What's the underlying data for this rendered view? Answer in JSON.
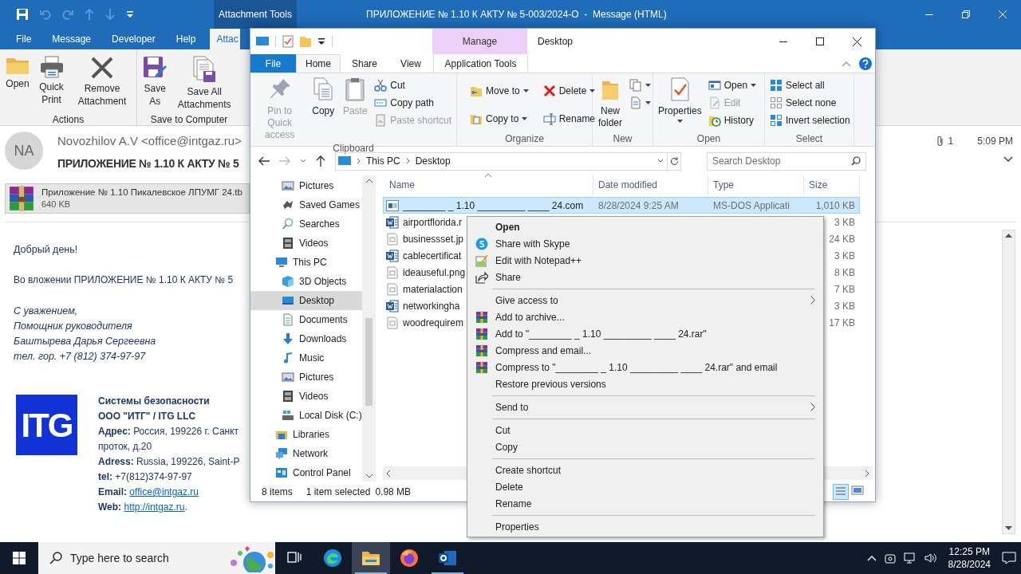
{
  "outlook": {
    "contextual_group": "Attachment Tools",
    "title": "ПРИЛОЖЕНИЕ № 1.10 К АКТУ № 5-003/2024-О  -  Message (HTML)",
    "tabs": [
      {
        "label": "File",
        "selected": false
      },
      {
        "label": "Message",
        "selected": false
      },
      {
        "label": "Developer",
        "selected": false
      },
      {
        "label": "Help",
        "selected": false
      },
      {
        "label": "Attac",
        "selected": true
      }
    ],
    "ribbon_groups": [
      {
        "label": "Actions",
        "buttons": [
          "Open",
          "Quick Print",
          "Remove Attachment"
        ]
      },
      {
        "label": "Save to Computer",
        "buttons": [
          "Save As",
          "Save All Attachments"
        ]
      }
    ],
    "message": {
      "avatar": "NA",
      "from": "Novozhilov A.V <office@intgaz.ru>",
      "subject": "ПРИЛОЖЕНИЕ № 1.10 К АКТУ № 5",
      "attachment_count": "1",
      "time": "5:09 PM"
    },
    "attachment": {
      "name": "Приложение № 1.10 Пикалевское ЛПУМГ 24.tb",
      "size": "640 KB"
    },
    "body": {
      "greeting": "Добрый день!",
      "text": "Во вложении ПРИЛОЖЕНИЕ № 1.10 К АКТУ № 5",
      "closing": [
        "С уважением,",
        "Помощник руководителя",
        "Баштырева Дарья Сергеевна",
        "тел. гор. +7 (812) 374-97-97"
      ]
    },
    "signature": {
      "logo": "ITG",
      "lines": [
        {
          "text": "**Системы безопасности**"
        },
        {
          "text": "**ООО \"ИТГ\" / ITG LLC**"
        },
        {
          "text": "**Адрес:** Россия, 199226  г. Санкт"
        },
        {
          "text": "проток, д.20"
        },
        {
          "text": "**Adress:** Russia, 199226,  Saint-P"
        },
        {
          "text": "**tel:** +7(812)374-97-97"
        },
        {
          "text": "**Email:** ",
          "link": "office@intgaz.ru"
        },
        {
          "text": "**Web:** ",
          "link": "http://intgaz.ru",
          "after": "."
        }
      ]
    }
  },
  "explorer": {
    "title": "Desktop",
    "contextual_tab": "Manage",
    "tabs": [
      {
        "label": "File",
        "selected": false
      },
      {
        "label": "Home",
        "selected": true
      },
      {
        "label": "Share",
        "selected": false
      },
      {
        "label": "View",
        "selected": false
      },
      {
        "label": "Application Tools",
        "selected": false
      }
    ],
    "ribbon_groups": [
      {
        "label": "Clipboard",
        "items": [
          {
            "kind": "large",
            "label": "Pin to Quick access",
            "disabled": true,
            "dropdown": false
          },
          {
            "kind": "large",
            "label": "Copy",
            "disabled": false,
            "dropdown": false
          },
          {
            "kind": "large",
            "label": "Paste",
            "disabled": true,
            "dropdown": false
          },
          {
            "kind": "small",
            "label": "Cut",
            "disabled": false,
            "dropdown": false
          },
          {
            "kind": "small",
            "label": "Copy path",
            "disabled": false,
            "dropdown": false
          },
          {
            "kind": "small",
            "label": "Paste shortcut",
            "disabled": true,
            "dropdown": false
          }
        ]
      },
      {
        "label": "Organize",
        "items": [
          {
            "kind": "medium",
            "label": "Move to",
            "disabled": false,
            "dropdown": true
          },
          {
            "kind": "medium",
            "label": "Copy to",
            "disabled": false,
            "dropdown": true
          },
          {
            "kind": "medium",
            "label": "Delete",
            "disabled": false,
            "dropdown": true
          },
          {
            "kind": "medium",
            "label": "Rename",
            "disabled": false,
            "dropdown": false
          }
        ]
      },
      {
        "label": "New",
        "items": [
          {
            "kind": "large",
            "label": "New folder",
            "disabled": false,
            "dropdown": false
          },
          {
            "kind": "icon",
            "disabled": false,
            "dropdown": true
          },
          {
            "kind": "icon",
            "disabled": false,
            "dropdown": true
          }
        ]
      },
      {
        "label": "Open",
        "items": [
          {
            "kind": "large",
            "label": "Properties",
            "disabled": false,
            "dropdown": true
          },
          {
            "kind": "small",
            "label": "Open",
            "disabled": false,
            "dropdown": true
          },
          {
            "kind": "small",
            "label": "Edit",
            "disabled": true,
            "dropdown": false
          },
          {
            "kind": "small",
            "label": "History",
            "disabled": false,
            "dropdown": false
          }
        ]
      },
      {
        "label": "Select",
        "items": [
          {
            "kind": "small",
            "label": "Select all",
            "disabled": false,
            "dropdown": false
          },
          {
            "kind": "small",
            "label": "Select none",
            "disabled": false,
            "dropdown": false
          },
          {
            "kind": "small",
            "label": "Invert selection",
            "disabled": false,
            "dropdown": false
          }
        ]
      }
    ],
    "path": [
      "This PC",
      "Desktop"
    ],
    "search_placeholder": "Search Desktop",
    "nav_tree": [
      {
        "children": [
          {
            "label": "Pictures",
            "selected": false
          },
          {
            "label": "Saved Games",
            "selected": false
          },
          {
            "label": "Searches",
            "selected": false
          },
          {
            "label": "Videos",
            "selected": false
          }
        ]
      },
      {
        "label": "This PC",
        "selected": false,
        "children": [
          {
            "label": "3D Objects",
            "selected": false
          },
          {
            "label": "Desktop",
            "selected": true
          },
          {
            "label": "Documents",
            "selected": false
          },
          {
            "label": "Downloads",
            "selected": false
          },
          {
            "label": "Music",
            "selected": false
          },
          {
            "label": "Pictures",
            "selected": false
          },
          {
            "label": "Videos",
            "selected": false
          },
          {
            "label": "Local Disk (C:)",
            "selected": false
          }
        ]
      },
      {
        "label": "Libraries",
        "selected": false
      },
      {
        "label": "Network",
        "selected": false
      },
      {
        "label": "Control Panel",
        "selected": false
      }
    ],
    "columns": [
      "Name",
      "Date modified",
      "Type",
      "Size"
    ],
    "files": [
      {
        "kind": "app",
        "name": "________ _ 1.10 _________ ____ 24.com",
        "date": "8/28/2024 9:25 AM",
        "type": "MS-DOS Applicati",
        "size": "1,010 KB",
        "selected": true
      },
      {
        "kind": "document",
        "name": "airportflorida.r",
        "size": "3 KB",
        "selected": false
      },
      {
        "kind": "file",
        "name": "businessset.jp",
        "size": "24 KB",
        "selected": false
      },
      {
        "kind": "document",
        "name": "cablecertificat",
        "size": "3 KB",
        "selected": false
      },
      {
        "kind": "file",
        "name": "ideauseful.png",
        "size": "8 KB",
        "selected": false
      },
      {
        "kind": "file",
        "name": "materialaction",
        "size": "7 KB",
        "selected": false
      },
      {
        "kind": "document",
        "name": "networkingha",
        "size": "3 KB",
        "selected": false
      },
      {
        "kind": "file",
        "name": "woodrequirem",
        "size": "17 KB",
        "selected": false
      }
    ],
    "status": {
      "count": "8 items",
      "selection": "1 item selected",
      "size": "0.98 MB"
    }
  },
  "context_menu": [
    {
      "kind": "item",
      "label": "Open",
      "default": true,
      "submenu": false
    },
    {
      "kind": "item",
      "label": "Share with Skype",
      "default": false,
      "submenu": false
    },
    {
      "kind": "item",
      "label": "Edit with Notepad++",
      "default": false,
      "submenu": false
    },
    {
      "kind": "item",
      "label": "Share",
      "default": false,
      "submenu": false
    },
    {
      "kind": "separator"
    },
    {
      "kind": "item",
      "label": "Give access to",
      "default": false,
      "submenu": true
    },
    {
      "kind": "item",
      "label": "Add to archive...",
      "default": false,
      "submenu": false
    },
    {
      "kind": "item",
      "label": "Add to \"________ _ 1.10 _________ ____ 24.rar\"",
      "default": false,
      "submenu": false
    },
    {
      "kind": "item",
      "label": "Compress and email...",
      "default": false,
      "submenu": false
    },
    {
      "kind": "item",
      "label": "Compress to \"________ _ 1.10 _________ ____ 24.rar\" and email",
      "default": false,
      "submenu": false
    },
    {
      "kind": "item",
      "label": "Restore previous versions",
      "default": false,
      "submenu": false
    },
    {
      "kind": "separator"
    },
    {
      "kind": "item",
      "label": "Send to",
      "default": false,
      "submenu": true
    },
    {
      "kind": "separator"
    },
    {
      "kind": "item",
      "label": "Cut",
      "default": false,
      "submenu": false
    },
    {
      "kind": "item",
      "label": "Copy",
      "default": false,
      "submenu": false
    },
    {
      "kind": "separator"
    },
    {
      "kind": "item",
      "label": "Create shortcut",
      "default": false,
      "submenu": false
    },
    {
      "kind": "item",
      "label": "Delete",
      "default": false,
      "submenu": false
    },
    {
      "kind": "item",
      "label": "Rename",
      "default": false,
      "submenu": false
    },
    {
      "kind": "separator"
    },
    {
      "kind": "item",
      "label": "Properties",
      "default": false,
      "submenu": false
    }
  ],
  "taskbar": {
    "search_placeholder": "Type here to search",
    "apps": [
      {
        "active": false,
        "running": false
      },
      {
        "active": true,
        "running": true
      },
      {
        "active": false,
        "running": false
      },
      {
        "active": false,
        "running": true
      }
    ],
    "time": "12:25 PM",
    "date": "8/28/2024"
  }
}
